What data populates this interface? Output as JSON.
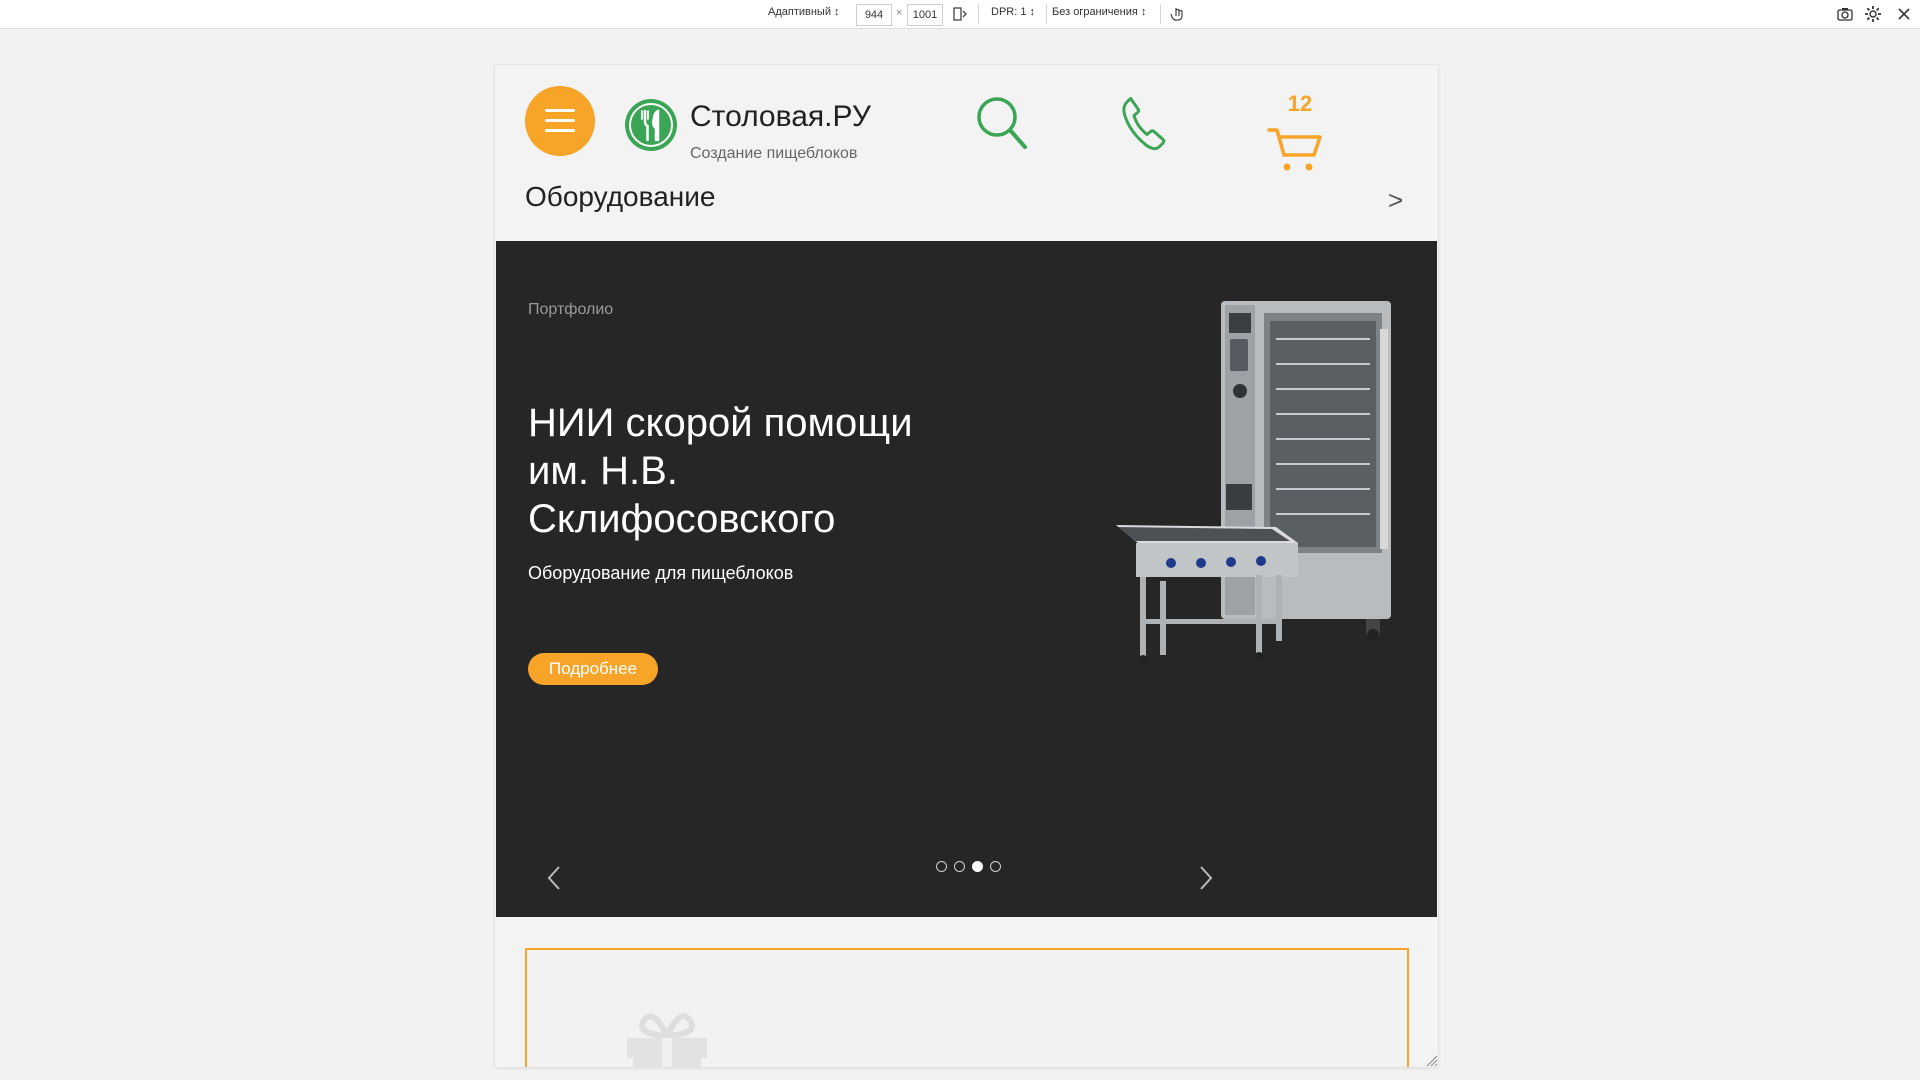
{
  "devtools": {
    "device": "Адаптивный",
    "width": "944",
    "times": "×",
    "height": "1001",
    "dpr": "DPR: 1",
    "throttle": "Без ограничения"
  },
  "header": {
    "logo_title": "Столовая.РУ",
    "logo_subtitle": "Создание пищеблоков",
    "cart_count": "12"
  },
  "section": {
    "title": "Оборудование",
    "arrow": ">"
  },
  "slide": {
    "eyebrow": "Портфолио",
    "title": "НИИ скорой помощи им. Н.В. Склифосовского",
    "subtitle": "Оборудование для пищеблоков",
    "button": "Подробнее"
  },
  "slider": {
    "total_slides": 4,
    "active_slide": 3
  },
  "colors": {
    "accent": "#f7a428",
    "green": "#3aa655",
    "slider_bg": "#262626"
  },
  "icons": [
    "menu-icon",
    "fork-knife-icon",
    "search-icon",
    "phone-icon",
    "cart-icon",
    "chevron-left-icon",
    "chevron-right-icon"
  ]
}
